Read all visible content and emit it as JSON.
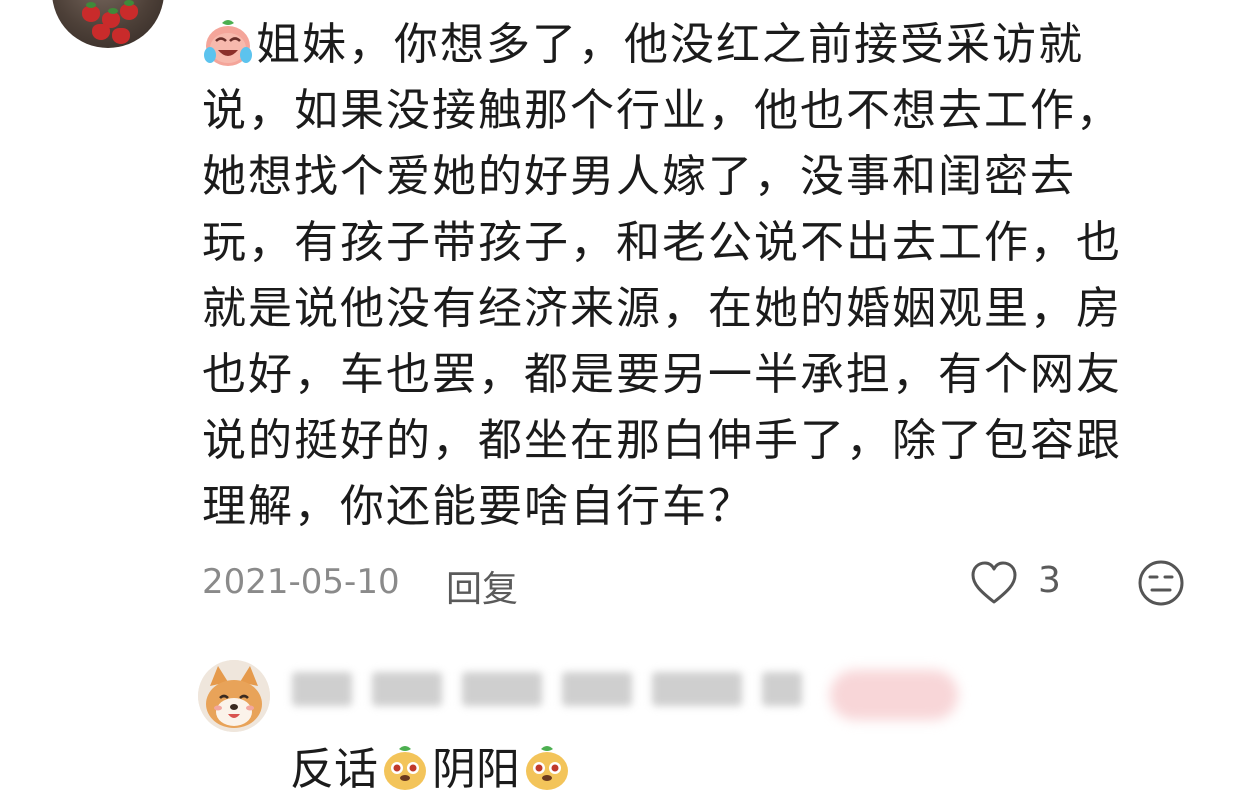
{
  "comment": {
    "lines": [
      "姐妹，你想多了，他没红之前接受采访就",
      "说，如果没接触那个行业，他也不想去工作，",
      "她想找个爱她的好男人嫁了，没事和闺密去",
      "玩，有孩子带孩子，和老公说不出去工作，也",
      "就是说他没有经济来源，在她的婚姻观里，房",
      "也好，车也罢，都是要另一半承担，有个网友",
      "说的挺好的，都坐在那白伸手了，除了包容跟",
      "理解，你还能要啥自行车？"
    ],
    "leading_emoji": "crying-laugh-emoji",
    "date": "2021-05-10",
    "reply_label": "回复",
    "like_count": "3",
    "like_icon": "heart-outline-icon",
    "dislike_icon": "dislike-face-icon"
  },
  "reply": {
    "author_avatar": "shiba-dog-avatar",
    "text_part1": "反话",
    "text_part2": "阴阳",
    "emoji": "doge-emoji"
  }
}
